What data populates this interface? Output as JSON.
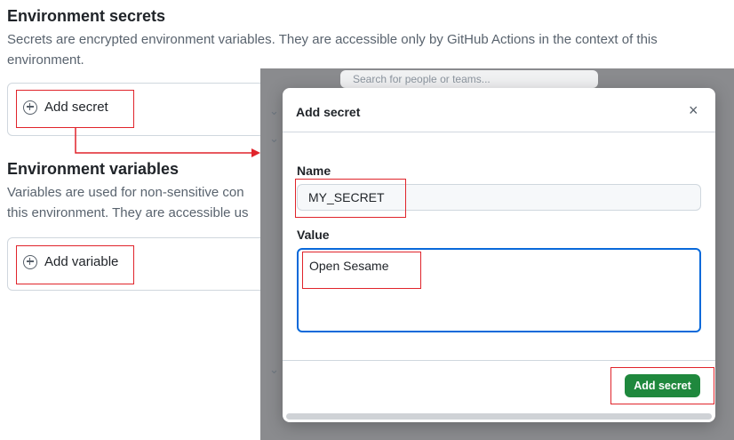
{
  "page": {
    "secrets_heading": "Environment secrets",
    "secrets_desc_line1": "Secrets are encrypted environment variables. They are accessible only by GitHub Actions in the context of this",
    "secrets_desc_line2": "environment.",
    "add_secret_label": "Add secret",
    "variables_heading": "Environment variables",
    "variables_desc_line1": "Variables are used for non-sensitive con",
    "variables_desc_line2": "this environment. They are accessible us",
    "add_variable_label": "Add variable"
  },
  "background_search": {
    "placeholder": "Search for people or teams..."
  },
  "dialog": {
    "title": "Add secret",
    "close_glyph": "×",
    "name_label": "Name",
    "name_value": "MY_SECRET",
    "value_label": "Value",
    "value_text": "Open Sesame",
    "submit_label": "Add secret"
  },
  "icons": {
    "plus": "plus-circle-icon",
    "close": "close-icon",
    "chevron": "chevron-down-icon"
  },
  "colors": {
    "annotation_red": "#e0242b",
    "primary_green": "#1f883d",
    "focus_blue": "#0969da"
  }
}
